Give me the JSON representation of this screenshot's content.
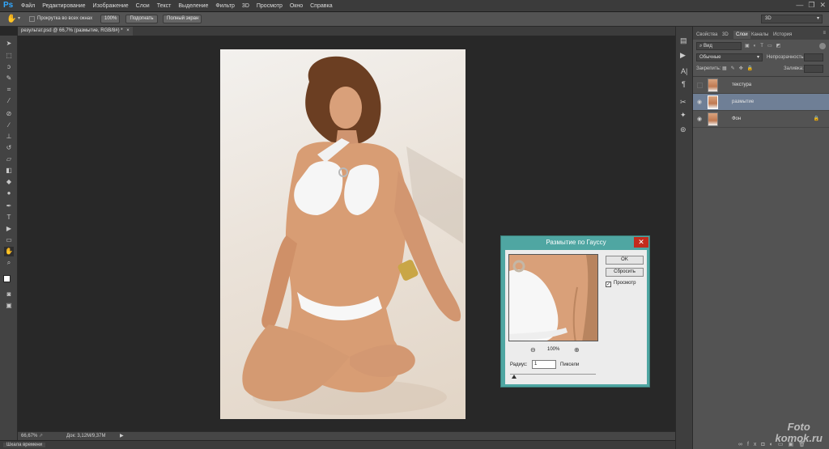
{
  "app": {
    "logo": "Ps"
  },
  "menu": [
    "Файл",
    "Редактирование",
    "Изображение",
    "Слои",
    "Текст",
    "Выделение",
    "Фильтр",
    "3D",
    "Просмотр",
    "Окно",
    "Справка"
  ],
  "window_controls": {
    "minimize": "—",
    "restore": "❐",
    "close": "✕"
  },
  "options_bar": {
    "scroll_all_windows": "Прокрутка во всех окнах",
    "btn_100": "100%",
    "btn_fit": "Подогнать",
    "btn_fullscreen": "Полный экран",
    "workspace": "3D"
  },
  "document": {
    "tab_title": "результат.psd @ 66,7% (размытие, RGB/8#) *"
  },
  "status": {
    "zoom": "66,67%",
    "doc_size": "Док: 3,12M/9,37M",
    "arrow": "▶"
  },
  "timeline": {
    "label": "Шкала времени"
  },
  "panel": {
    "tabs": [
      "Свойства",
      "3D",
      "Слои",
      "Каналы",
      "История"
    ],
    "active_tab": "Слои",
    "filter_kind": "Вид",
    "blend_mode": "Обычные",
    "opacity_label": "Непрозрачность:",
    "lock_label": "Закрепить:",
    "fill_label": "Заливка:",
    "layers": [
      {
        "name": "текстура",
        "visible": false,
        "selected": false
      },
      {
        "name": "размытие",
        "visible": true,
        "selected": true
      },
      {
        "name": "Фон",
        "visible": true,
        "selected": false,
        "locked": true
      }
    ]
  },
  "dialog": {
    "title": "Размытие по Гауссу",
    "close": "✕",
    "ok": "OK",
    "reset": "Сбросить",
    "preview_label": "Просмотр",
    "preview_checked": true,
    "zoom": "100%",
    "radius_label": "Радиус:",
    "radius_value": "1",
    "radius_unit": "Пиксели"
  },
  "watermark": {
    "line1": "Foto",
    "line2": "komok.ru"
  }
}
